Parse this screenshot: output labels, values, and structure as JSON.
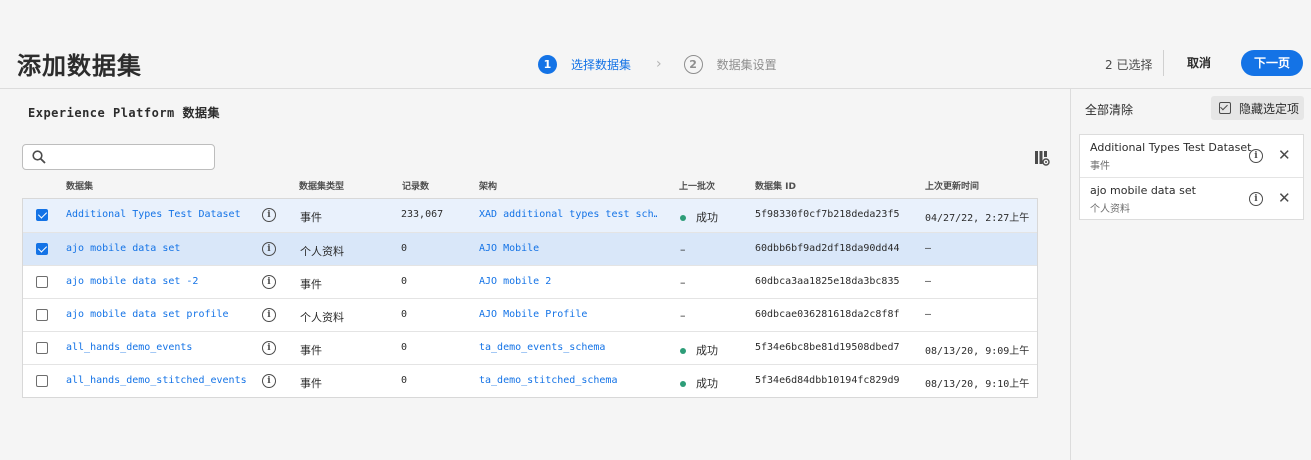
{
  "header": {
    "title": "添加数据集",
    "steps": [
      {
        "num": "1",
        "label": "选择数据集"
      },
      {
        "num": "2",
        "label": "数据集设置"
      }
    ],
    "selected_count": "2 已选择",
    "cancel_label": "取消",
    "next_label": "下一页"
  },
  "main": {
    "title": "Experience Platform 数据集",
    "search": {
      "placeholder": "",
      "value": ""
    },
    "columns": [
      "数据集",
      "数据集类型",
      "记录数",
      "架构",
      "上一批次",
      "数据集 ID",
      "上次更新时间"
    ],
    "rows": [
      {
        "checked": true,
        "name": "Additional Types Test Dataset",
        "type": "事件",
        "records": "233,067",
        "schema": "XAD additional types test sch…",
        "batch": "成功",
        "batch_ok": true,
        "id": "5f98330f0cf7b218deda23f5",
        "updated": "04/27/22, 2:27上午"
      },
      {
        "checked": true,
        "name": "ajo mobile data set",
        "type": "个人资料",
        "records": "0",
        "schema": "AJO Mobile",
        "batch": "–",
        "batch_ok": false,
        "id": "60dbb6bf9ad2df18da90dd44",
        "updated": "–"
      },
      {
        "checked": false,
        "name": "ajo mobile data set -2",
        "type": "事件",
        "records": "0",
        "schema": "AJO mobile 2",
        "batch": "–",
        "batch_ok": false,
        "id": "60dbca3aa1825e18da3bc835",
        "updated": "–"
      },
      {
        "checked": false,
        "name": "ajo mobile data set profile",
        "type": "个人资料",
        "records": "0",
        "schema": "AJO Mobile Profile",
        "batch": "–",
        "batch_ok": false,
        "id": "60dbcae036281618da2c8f8f",
        "updated": "–"
      },
      {
        "checked": false,
        "name": "all_hands_demo_events",
        "type": "事件",
        "records": "0",
        "schema": "ta_demo_events_schema",
        "batch": "成功",
        "batch_ok": true,
        "id": "5f34e6bc8be81d19508dbed7",
        "updated": "08/13/20, 9:09上午"
      },
      {
        "checked": false,
        "name": "all_hands_demo_stitched_events",
        "type": "事件",
        "records": "0",
        "schema": "ta_demo_stitched_schema",
        "batch": "成功",
        "batch_ok": true,
        "id": "5f34e6d84dbb10194fc829d9",
        "updated": "08/13/20, 9:10上午"
      }
    ]
  },
  "panel": {
    "clear_all": "全部清除",
    "hide_selected": "隐藏选定项",
    "items": [
      {
        "name": "Additional Types Test Dataset",
        "type": "事件"
      },
      {
        "name": "ajo mobile data set",
        "type": "个人资料"
      }
    ]
  },
  "colors": {
    "accent": "#1473e6",
    "success": "#2d9d78"
  }
}
